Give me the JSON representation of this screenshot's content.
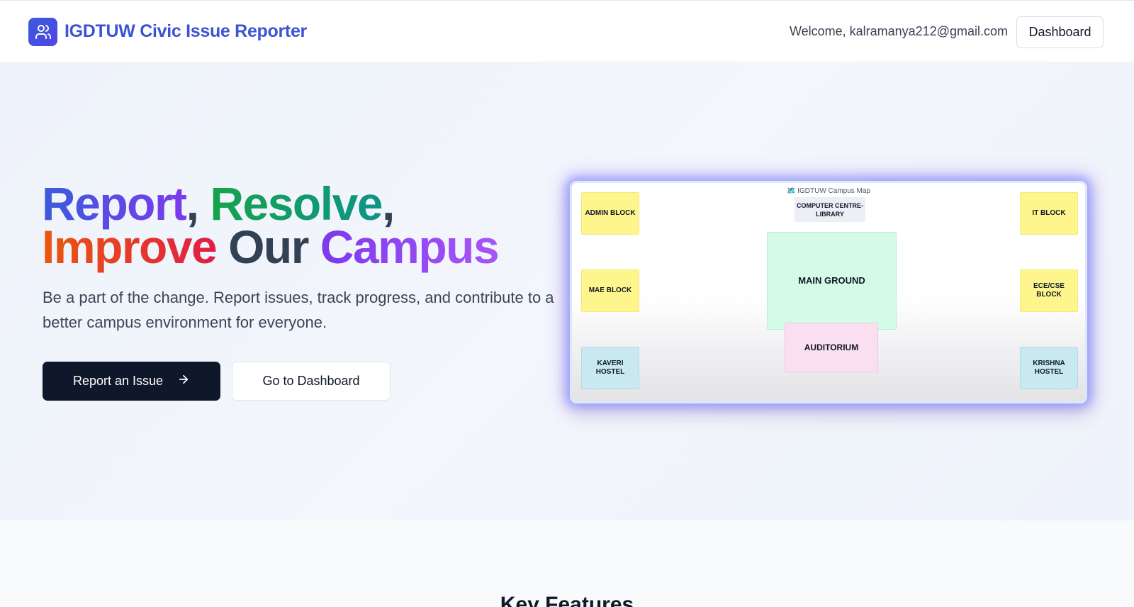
{
  "header": {
    "brand": "IGDTUW Civic Issue Reporter",
    "brand_icon": "users-icon",
    "welcome": "Welcome, kalramanya212@gmail.com",
    "dashboard_label": "Dashboard"
  },
  "hero": {
    "headline": {
      "report": "Report",
      "comma1": ",",
      "resolve": "Resolve",
      "comma2": ",",
      "improve": "Improve",
      "our": "Our",
      "campus": "Campus"
    },
    "subtitle": "Be a part of the change. Report issues, track progress, and contribute to a better campus environment for everyone.",
    "primary_button": "Report an Issue",
    "primary_button_icon": "arrow-right-icon",
    "secondary_button": "Go to Dashboard"
  },
  "map": {
    "title": "🗺️ IGDTUW Campus Map",
    "blocks": {
      "admin": "ADMIN BLOCK",
      "library": "COMPUTER CENTRE-LIBRARY",
      "it": "IT BLOCK",
      "mae": "MAE BLOCK",
      "main_ground": "MAIN GROUND",
      "ece_cse": "ECE/CSE BLOCK",
      "auditorium": "AUDITORIUM",
      "kaveri": "KAVERI HOSTEL",
      "krishna": "KRISHNA HOSTEL"
    }
  },
  "features": {
    "title": "Key Features"
  },
  "colors": {
    "brand": "#3b54d6",
    "primary_button": "#0f172a",
    "building_yellow": "#fef68c",
    "hostel_blue": "#c8e9f0",
    "ground_green": "#d3fbe6",
    "auditorium_pink": "#f9dff0"
  }
}
